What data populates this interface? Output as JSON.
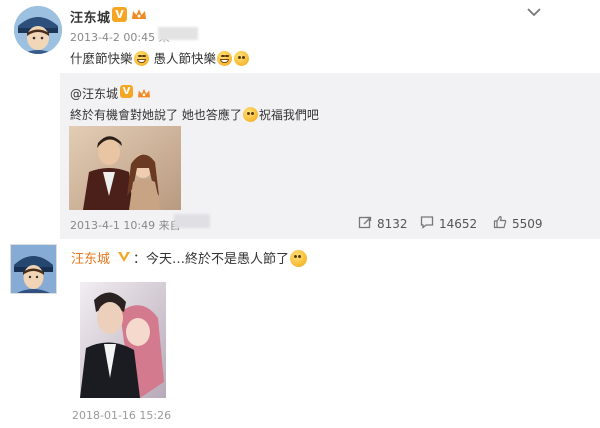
{
  "post1": {
    "username": "汪东城",
    "verified_badge": "V",
    "timestamp": "2013-4-2 00:45",
    "source_prefix": "来",
    "text_a": "什麼節快樂",
    "text_b": "愚人節快樂",
    "repost": {
      "username": "@汪东城",
      "verified_badge": "V",
      "text": "終於有機會對她說了 她也答應了",
      "text_tail": "祝福我們吧",
      "timestamp": "2013-4-1 10:49",
      "source_prefix": "来自",
      "stats": {
        "reposts": "8132",
        "comments": "14652",
        "likes": "5509"
      }
    }
  },
  "post2": {
    "username": "汪东城",
    "separator": "：",
    "text": "今天…終於不是愚人節了",
    "timestamp": "2018-01-16 15:26"
  },
  "colors": {
    "accent_orange": "#e8761a",
    "verified_gold": "#f5a623",
    "repost_bg": "#f2f2f5",
    "meta_gray": "#888888"
  },
  "icons": [
    "chevron-down-icon",
    "verified-icon",
    "crown-icon",
    "repost-icon",
    "comment-icon",
    "like-icon",
    "smile-emoji-icon",
    "grin-emoji-icon",
    "think-emoji-icon"
  ]
}
